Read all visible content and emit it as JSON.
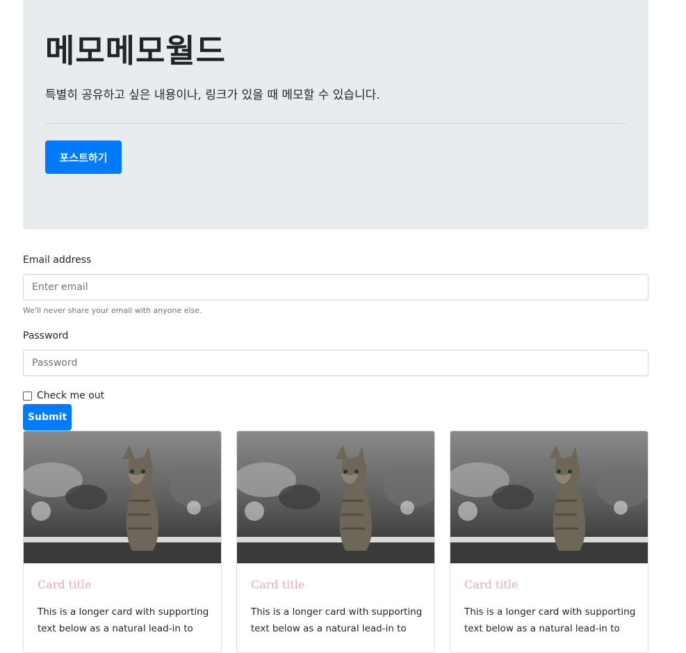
{
  "jumbotron": {
    "title": "메모메모월드",
    "lead": "특별히 공유하고 싶은 내용이나, 링크가 있을 때 메모할 수 있습니다.",
    "button_label": "포스트하기"
  },
  "form": {
    "email_label": "Email address",
    "email_placeholder": "Enter email",
    "email_help": "We'll never share your email with anyone else.",
    "password_label": "Password",
    "password_placeholder": "Password",
    "checkbox_label": "Check me out",
    "checkbox_checked": false,
    "submit_label": "Submit"
  },
  "cards": [
    {
      "title": "Card title",
      "text": "This is a longer card with supporting text below as a natural lead-in to",
      "image": "kitten-photo"
    },
    {
      "title": "Card title",
      "text": "This is a longer card with supporting text below as a natural lead-in to",
      "image": "kitten-photo"
    },
    {
      "title": "Card title",
      "text": "This is a longer card with supporting text below as a natural lead-in to",
      "image": "kitten-photo"
    }
  ],
  "colors": {
    "primary": "#007bff",
    "jumbotron_bg": "#e9ecef",
    "card_title": "#f4a7b9"
  }
}
